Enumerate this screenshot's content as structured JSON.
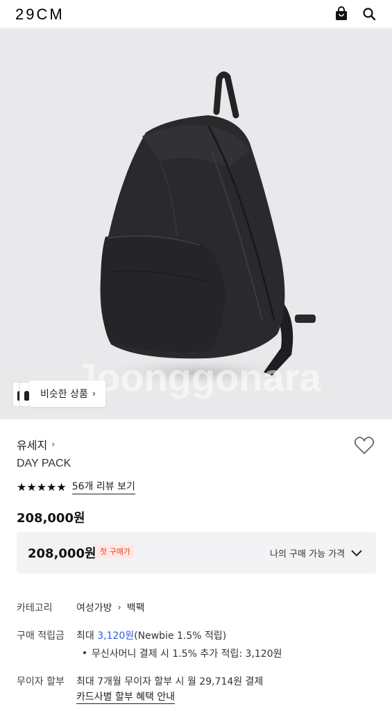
{
  "header": {
    "logo": "29CM",
    "icons": [
      "shopping-bag-icon",
      "search-icon"
    ]
  },
  "hero": {
    "watermark": "Joonggonara",
    "similar_label": "비슷한 상품",
    "similar_chevron": "›"
  },
  "product": {
    "brand": "유세지",
    "brand_chevron": "›",
    "name": "DAY PACK",
    "stars": "★★★★★",
    "review_link": "56개 리뷰 보기",
    "price": "208,000원"
  },
  "my_price": {
    "price": "208,000원",
    "badge": "첫 구매가",
    "label": "나의 구매 가능 가격"
  },
  "details": {
    "category_label": "카테고리",
    "category_1": "여성가방",
    "category_sep": "›",
    "category_2": "백팩",
    "points_label": "구매 적립금",
    "points_prefix": "최대 ",
    "points_amount": "3,120원",
    "points_suffix": "(Newbie 1.5% 적립)",
    "points_sub": "무신사머니 결제 시 1.5% 추가 적립: 3,120원",
    "installment_label": "무이자 할부",
    "installment_value": "최대 7개월 무이자 할부 시 월 29,714원 결제",
    "installment_link": "카드사별 할부 혜택 안내"
  }
}
